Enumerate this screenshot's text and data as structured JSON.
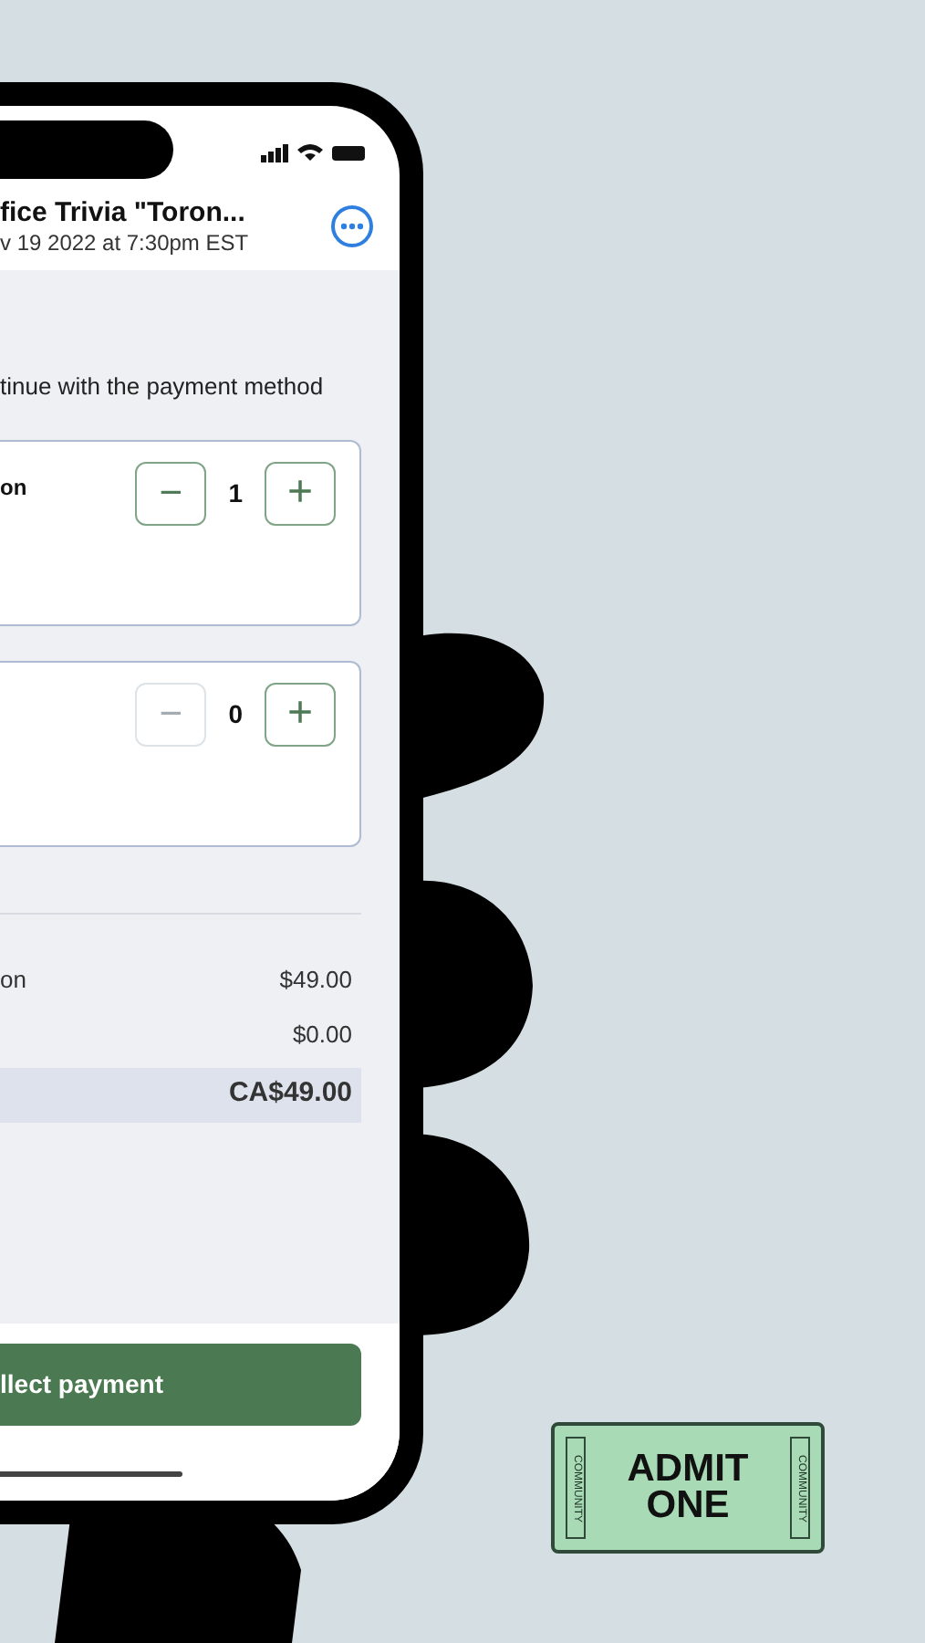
{
  "header": {
    "title": "fice Trivia \"Toron...",
    "subtitle": "v 19 2022 at 7:30pm EST"
  },
  "instruction": "tinue with the payment method",
  "tickets": [
    {
      "name": "on",
      "count": "1",
      "minus_disabled": false,
      "minus": "−",
      "plus": "+"
    },
    {
      "count": "0",
      "minus_disabled": true,
      "minus": "−",
      "plus": "+"
    }
  ],
  "summary": [
    {
      "label": "on",
      "amount": "$49.00"
    },
    {
      "amount": "$0.00"
    }
  ],
  "total": {
    "amount": "CA$49.00"
  },
  "pay_button": "llect payment",
  "stamp": {
    "side_left": "COMMUNITY",
    "line_1": "ADMIT",
    "line_2": "ONE",
    "side_right": "COMMUNITY"
  }
}
